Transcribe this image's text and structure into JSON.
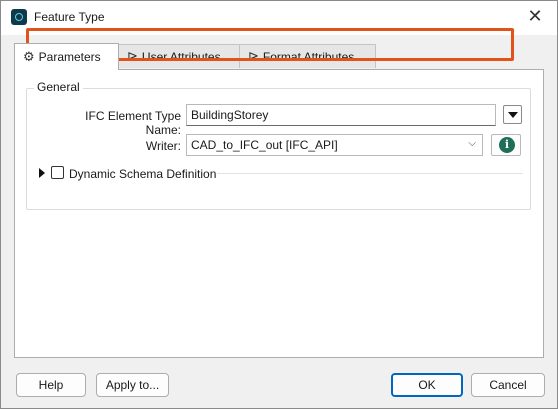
{
  "window": {
    "title": "Feature Type",
    "close_glyph": "✕"
  },
  "tabs": [
    {
      "label": "Parameters",
      "icon": "gear-icon",
      "glyph": "⚙",
      "active": true
    },
    {
      "label": "User Attributes",
      "icon": "attributes-arrow-icon",
      "glyph": "⊳",
      "active": false
    },
    {
      "label": "Format Attributes",
      "icon": "attributes-arrow-icon",
      "glyph": "⊳",
      "active": false
    }
  ],
  "general": {
    "group_label": "General",
    "element_type": {
      "label": "IFC Element Type Name:",
      "value": "BuildingStorey"
    },
    "writer": {
      "label": "Writer:",
      "value": "CAD_to_IFC_out [IFC_API]",
      "chevron": "⌵"
    },
    "info_glyph": "i"
  },
  "dynamic_schema": {
    "label": "Dynamic Schema Definition",
    "checked": false
  },
  "buttons": {
    "help": "Help",
    "apply": "Apply to...",
    "ok": "OK",
    "cancel": "Cancel"
  },
  "colors": {
    "highlight": "#e0541c",
    "accent": "#0067c0",
    "info": "#1f6f58"
  }
}
